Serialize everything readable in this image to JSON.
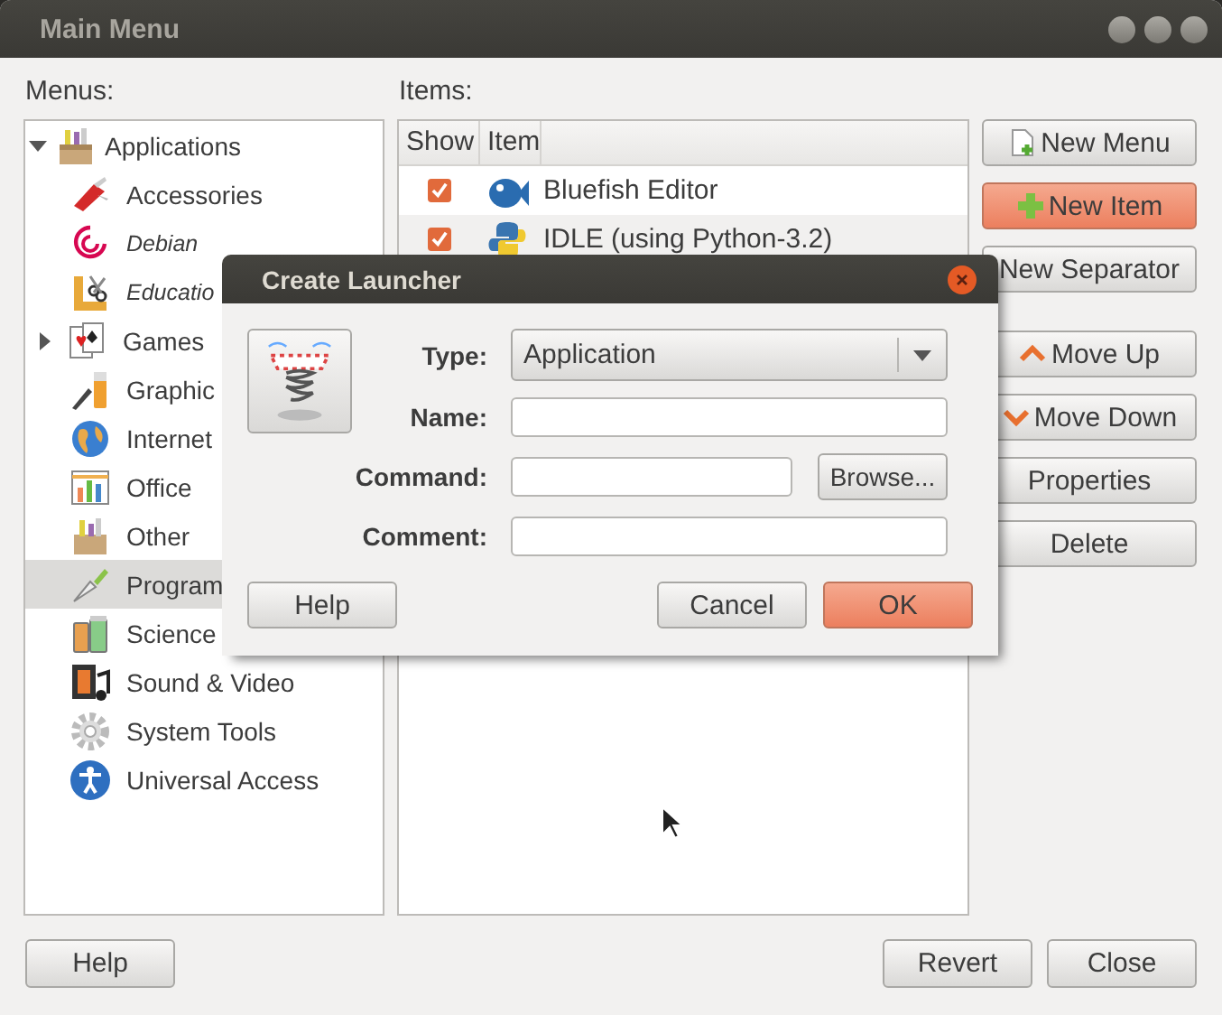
{
  "window": {
    "title": "Main Menu"
  },
  "menus": {
    "label": "Menus:",
    "tree": [
      {
        "label": "Applications",
        "kind": "submenu",
        "expanded": true,
        "selected": false,
        "visible": true,
        "children": [
          {
            "label": "Accessories",
            "kind": "leaf",
            "selected": false,
            "visible": true
          },
          {
            "label": "Debian",
            "kind": "leaf",
            "selected": false,
            "visible": false
          },
          {
            "label": "Educatio",
            "kind": "leaf",
            "selected": false,
            "visible": false
          },
          {
            "label": "Games",
            "kind": "submenu",
            "expanded": false,
            "selected": false,
            "visible": true
          },
          {
            "label": "Graphic",
            "kind": "leaf",
            "selected": false,
            "visible": true
          },
          {
            "label": "Internet",
            "kind": "leaf",
            "selected": false,
            "visible": true
          },
          {
            "label": "Office",
            "kind": "leaf",
            "selected": false,
            "visible": true
          },
          {
            "label": "Other",
            "kind": "leaf",
            "selected": false,
            "visible": true
          },
          {
            "label": "Program",
            "kind": "leaf",
            "selected": true,
            "visible": true
          },
          {
            "label": "Science",
            "kind": "leaf",
            "selected": false,
            "visible": true
          },
          {
            "label": "Sound & Video",
            "kind": "leaf",
            "selected": false,
            "visible": true
          },
          {
            "label": "System Tools",
            "kind": "leaf",
            "selected": false,
            "visible": true
          },
          {
            "label": "Universal Access",
            "kind": "leaf",
            "selected": false,
            "visible": true
          }
        ]
      }
    ]
  },
  "items": {
    "label": "Items:",
    "columns": [
      "Show",
      "Item"
    ],
    "rows": [
      {
        "show": true,
        "name": "Bluefish Editor"
      },
      {
        "show": true,
        "name": "IDLE (using Python-3.2)"
      }
    ]
  },
  "side_buttons": [
    {
      "label": "New Menu",
      "highlighted": false
    },
    {
      "label": "New Item",
      "highlighted": true
    },
    {
      "label": "New Separator",
      "highlighted": false
    },
    {
      "label": "Move Up",
      "highlighted": false
    },
    {
      "label": "Move Down",
      "highlighted": false
    },
    {
      "label": "Properties",
      "highlighted": false
    },
    {
      "label": "Delete",
      "highlighted": false
    }
  ],
  "bottom_buttons": [
    {
      "label": "Help",
      "highlighted": false
    },
    {
      "label": "Revert",
      "highlighted": false
    },
    {
      "label": "Close",
      "highlighted": false
    }
  ],
  "dialog": {
    "title": "Create Launcher",
    "fields": [
      {
        "label": "Type:",
        "kind": "combo",
        "value": "Application"
      },
      {
        "label": "Name:",
        "kind": "text"
      },
      {
        "label": "Command:",
        "kind": "browse",
        "button": "Browse..."
      },
      {
        "label": "Comment:",
        "kind": "text"
      }
    ],
    "buttons": [
      {
        "label": "Help",
        "highlighted": false
      },
      {
        "label": "Cancel",
        "highlighted": false
      },
      {
        "label": "OK",
        "highlighted": true
      }
    ]
  }
}
